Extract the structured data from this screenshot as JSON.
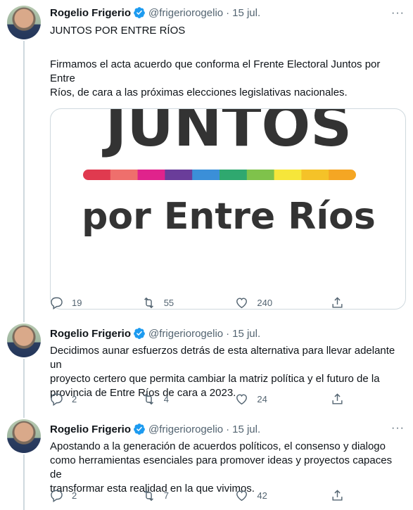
{
  "tweets": [
    {
      "author": "Rogelio Frigerio",
      "handle": "@frigeriorogelio",
      "separator": "·",
      "date": "15 jul.",
      "text_lines": [
        "JUNTOS POR ENTRE RÍOS",
        "",
        "Firmamos el acta acuerdo que conforma el Frente Electoral Juntos por Entre",
        "Ríos, de cara a las próximas elecciones legislativas nacionales."
      ],
      "media": {
        "logo_title": "JUNTOS",
        "logo_subtitle": "por Entre Ríos",
        "stripe_colors": [
          "#e03a4f",
          "#ef6f6c",
          "#e0238c",
          "#6a3d9a",
          "#3b8fd8",
          "#2fa86f",
          "#7fc24b",
          "#f6e63a",
          "#f5c228",
          "#f5a623"
        ]
      },
      "replies": "19",
      "retweets": "55",
      "likes": "240"
    },
    {
      "author": "Rogelio Frigerio",
      "handle": "@frigeriorogelio",
      "separator": "·",
      "date": "15 jul.",
      "text_lines": [
        "Decidimos aunar esfuerzos detrás de esta alternativa para llevar adelante un",
        "proyecto certero que permita cambiar la matriz política y el futuro de la",
        "provincia de Entre Ríos de cara a 2023."
      ],
      "replies": "2",
      "retweets": "4",
      "likes": "24"
    },
    {
      "author": "Rogelio Frigerio",
      "handle": "@frigeriorogelio",
      "separator": "·",
      "date": "15 jul.",
      "text_lines": [
        "Apostando a la generación de acuerdos políticos, el consenso y  dialogo",
        "como herramientas esenciales para promover ideas y proyectos capaces de",
        "transformar esta realidad en la que vivimos."
      ],
      "replies": "2",
      "retweets": "7",
      "likes": "42"
    }
  ],
  "colors": {
    "verified": "#1d9bf0",
    "secondary_text": "#536471",
    "thread_line": "#cfd9de"
  },
  "icons": {
    "reply": "reply-icon",
    "retweet": "retweet-icon",
    "like": "heart-icon",
    "share": "share-icon",
    "more": "more-icon",
    "verified": "verified-badge-icon"
  }
}
